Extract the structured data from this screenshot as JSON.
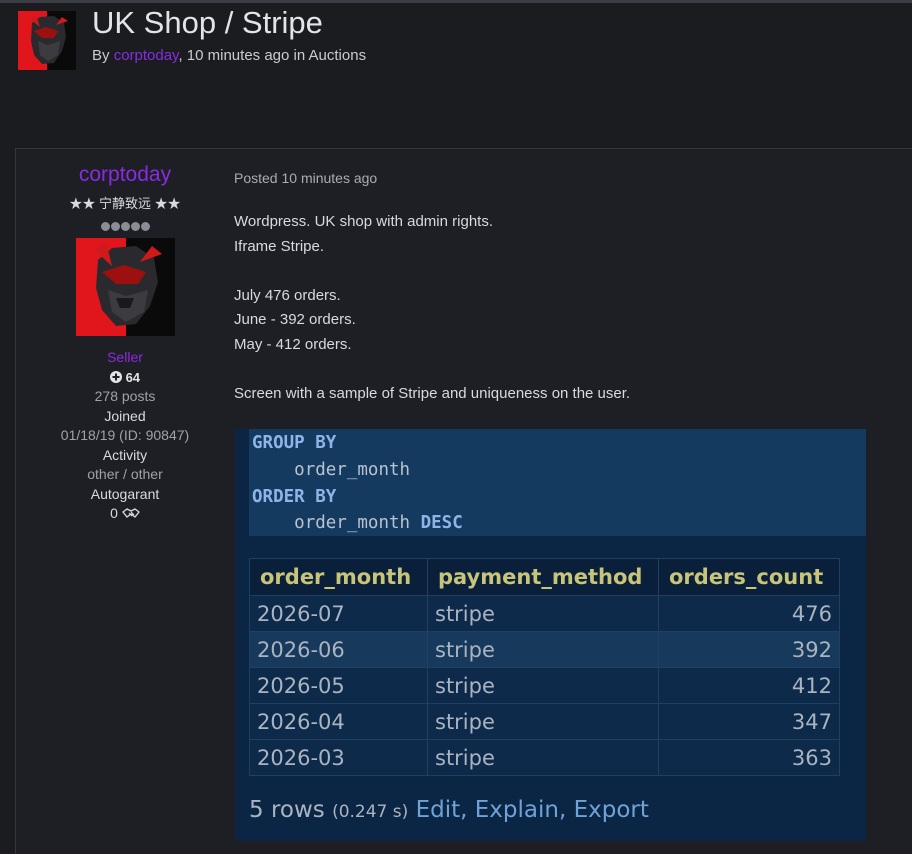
{
  "thread": {
    "title": "UK Shop / Stripe",
    "by_prefix": "By",
    "author": "corptoday",
    "time_sep": ", 10 minutes ago in",
    "forum": "Auctions"
  },
  "author": {
    "name": "corptoday",
    "title": "★★ 宁静致远 ★★",
    "group": "Seller",
    "reputation": "64",
    "posts": "278 posts",
    "joined_label": "Joined",
    "joined_value": "01/18/19 (ID: 90847)",
    "activity_label": "Activity",
    "activity_value": "other / other",
    "autogarant_label": "Autogarant",
    "autogarant_value": "0",
    "rank_pips": 5
  },
  "post": {
    "posted": "Posted 10 minutes ago",
    "lines": [
      "Wordpress. UK shop with admin rights.",
      "Iframe Stripe.",
      "",
      "July 476 orders.",
      "June - 392 orders.",
      "May - 412 orders.",
      "",
      "Screen with a sample of Stripe and uniqueness on the user."
    ]
  },
  "screenshot": {
    "code": {
      "kw_group": "GROUP BY",
      "group_col": "order_month",
      "kw_order": "ORDER BY",
      "order_col": "order_month",
      "kw_desc": "DESC"
    },
    "table": {
      "headers": [
        "order_month",
        "payment_method",
        "orders_count"
      ],
      "rows": [
        [
          "2026-07",
          "stripe",
          "476"
        ],
        [
          "2026-06",
          "stripe",
          "392"
        ],
        [
          "2026-05",
          "stripe",
          "412"
        ],
        [
          "2026-04",
          "stripe",
          "347"
        ],
        [
          "2026-03",
          "stripe",
          "363"
        ]
      ]
    },
    "footer": {
      "rows": "5 rows",
      "time": "(0.247 s)",
      "edit": "Edit,",
      "explain": "Explain,",
      "export": "Export"
    }
  },
  "colors": {
    "author_accent": "#8a2be2",
    "background": "#1a1c20",
    "avatar_red": "#e0161c",
    "sql_header": "#c8c47a",
    "sql_link": "#6fa3d8"
  },
  "icons": {
    "avatar": "red-black-mask-avatar",
    "reputation": "plus-circle-icon",
    "autogarant": "handshake-icon"
  }
}
